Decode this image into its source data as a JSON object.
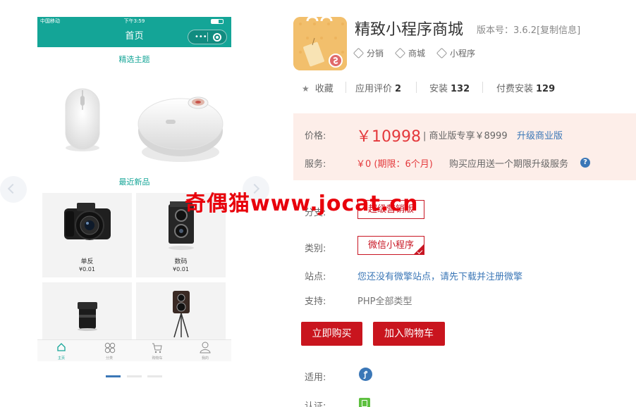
{
  "phone": {
    "status": {
      "carrier": "中国移动",
      "time": "下午3:59"
    },
    "nav_title": "首页",
    "section_featured": "精选主题",
    "section_new": "最近新品",
    "products": [
      {
        "name": "单反",
        "price": "¥0.01"
      },
      {
        "name": "数码",
        "price": "¥0.01"
      },
      {
        "name": "",
        "price": ""
      },
      {
        "name": "",
        "price": ""
      }
    ],
    "tabs": [
      {
        "label": "主页",
        "icon": "home-icon"
      },
      {
        "label": "分类",
        "icon": "category-icon"
      },
      {
        "label": "购物车",
        "icon": "cart-icon"
      },
      {
        "label": "我的",
        "icon": "user-icon"
      }
    ]
  },
  "app": {
    "title": "精致小程序商城",
    "version": "版本号：3.6.2[复制信息]",
    "tags": [
      "分销",
      "商城",
      "小程序"
    ],
    "stats": {
      "favorite_label": "收藏",
      "rating_label": "应用评价",
      "rating_value": "2",
      "install_label": "安装",
      "install_value": "132",
      "paid_label": "付费安装",
      "paid_value": "129"
    }
  },
  "pricing": {
    "price_label": "价格:",
    "price_value": "￥10998",
    "pro_text": "| 商业版专享￥8999",
    "upgrade_link": "升级商业版",
    "service_label": "服务:",
    "service_value": "￥0 (期限：6个月)",
    "service_text": "购买应用送一个期限升级服务"
  },
  "options": {
    "branch_label": "分支:",
    "branch_value": "超级营销版",
    "category_label": "类别:",
    "category_value": "微信小程序",
    "site_label": "站点:",
    "site_text": "您还没有微擎站点，请先下载并注册微擎",
    "support_label": "支持:",
    "support_value": "PHP全部类型"
  },
  "actions": {
    "buy_now": "立即购买",
    "add_cart": "加入购物车"
  },
  "bottom": {
    "applies_label": "适用:",
    "cert_label": "认证:"
  },
  "watermark": "奇偶猫www.jocat.cn"
}
